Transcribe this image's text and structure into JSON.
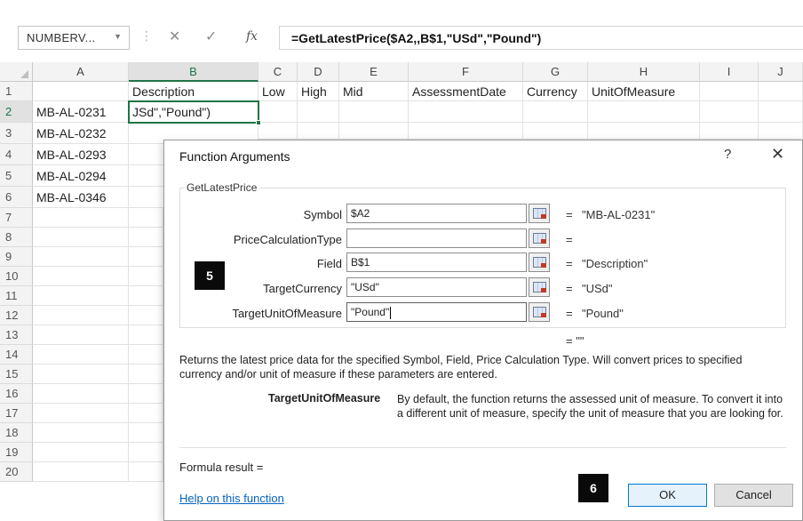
{
  "formula_bar": {
    "name_box": "NUMBERV...",
    "name_box_arrow": "▼",
    "separator": "⋮",
    "cancel_icon": "✕",
    "enter_icon": "✓",
    "fx_label": "fx",
    "formula": "=GetLatestPrice($A2,,B$1,\"USd\",\"Pound\")"
  },
  "sheet": {
    "columns": [
      "A",
      "B",
      "C",
      "D",
      "E",
      "F",
      "G",
      "H",
      "I",
      "J"
    ],
    "rows": [
      "1",
      "2",
      "3",
      "4",
      "5",
      "6",
      "7",
      "8",
      "9",
      "10",
      "11",
      "12",
      "13",
      "14",
      "15",
      "16",
      "17",
      "18",
      "19",
      "20"
    ],
    "header_row": {
      "B": "Description",
      "C": "Low",
      "D": "High",
      "E": "Mid",
      "F": "AssessmentDate",
      "G": "Currency",
      "H": "UnitOfMeasure"
    },
    "column_a": [
      "MB-AL-0231",
      "MB-AL-0232",
      "MB-AL-0293",
      "MB-AL-0294",
      "MB-AL-0346"
    ],
    "active_cell_text": "JSd\",\"Pound\")"
  },
  "dialog": {
    "title": "Function Arguments",
    "help_button": "?",
    "close_button": "✕",
    "function_name": "GetLatestPrice",
    "args": [
      {
        "label": "Symbol",
        "value": "$A2",
        "result": "\"MB-AL-0231\""
      },
      {
        "label": "PriceCalculationType",
        "value": "",
        "result": ""
      },
      {
        "label": "Field",
        "value": "B$1",
        "result": "\"Description\""
      },
      {
        "label": "TargetCurrency",
        "value": "\"USd\"",
        "result": "\"USd\""
      },
      {
        "label": "TargetUnitOfMeasure",
        "value": "\"Pound\"",
        "result": "\"Pound\""
      }
    ],
    "equals": "=",
    "overall_result": "= \"\"",
    "description": "Returns the latest price data for the specified Symbol, Field, Price Calculation Type. Will convert prices to specified currency and/or unit of measure if these parameters are entered.",
    "param_name": "TargetUnitOfMeasure",
    "param_description": "By default, the function returns the assessed unit of measure. To convert it into a different unit of measure, specify the unit of measure that you are looking for.",
    "formula_result_label": "Formula result =",
    "help_link": "Help on this function",
    "ok_label": "OK",
    "cancel_label": "Cancel"
  },
  "badges": {
    "step_5": "5",
    "step_6": "6"
  },
  "colors": {
    "excel_green": "#217346",
    "link_blue": "#0563c1",
    "ok_border": "#0078d7"
  }
}
